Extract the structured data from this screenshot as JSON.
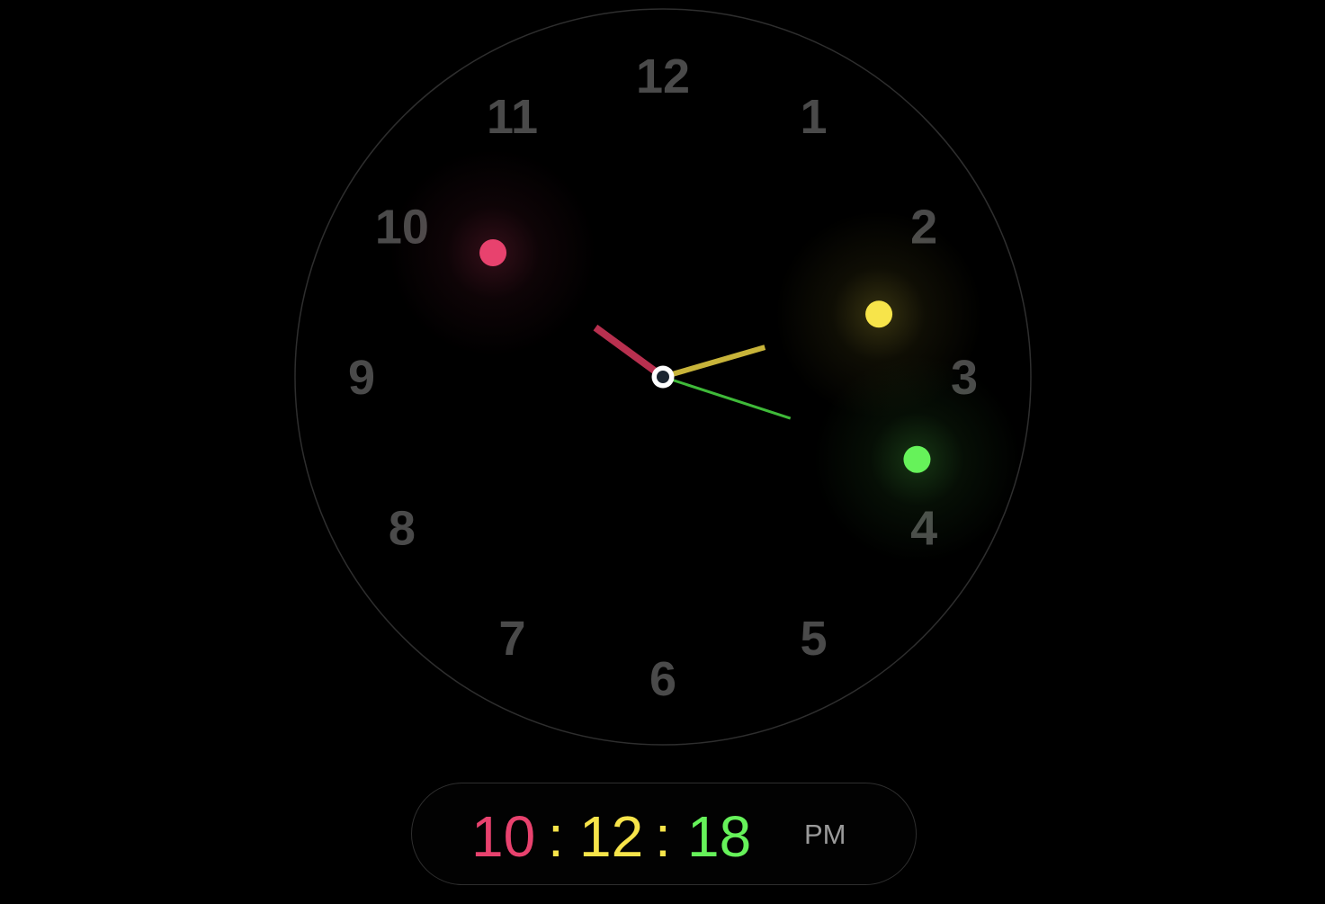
{
  "clock": {
    "numerals": [
      "12",
      "1",
      "2",
      "3",
      "4",
      "5",
      "6",
      "7",
      "8",
      "9",
      "10",
      "11"
    ],
    "time": {
      "hours": 10,
      "minutes": 12,
      "seconds": 18
    }
  },
  "readout": {
    "hours": "10",
    "separator": ":",
    "minutes": "12",
    "seconds": "18",
    "period": "PM"
  },
  "colors": {
    "background": "#000000",
    "numeral": "#4a4a4a",
    "dial_border": "#2e2e2e",
    "hours": "#e8426e",
    "hour_hand": "#b8304f",
    "minutes": "#f7e44a",
    "minute_hand": "#c8b43a",
    "seconds": "#66f25a",
    "second_hand": "#3fba39",
    "separator": "#f7e44a",
    "period": "#9a9a9a",
    "hub_ring": "#ffffff",
    "hub_center": "#1b2530"
  }
}
